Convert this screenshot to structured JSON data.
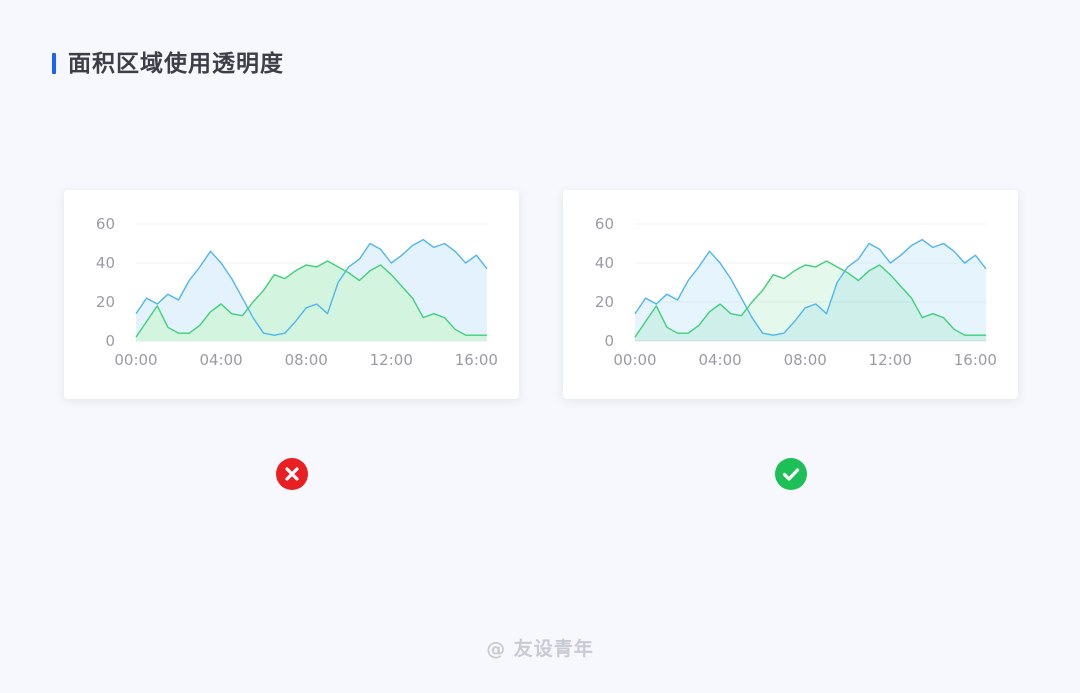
{
  "heading": {
    "title": "面积区域使用透明度"
  },
  "chart_data": [
    {
      "type": "area",
      "variant": "opaque-fill",
      "x": [
        "00:00",
        "00:30",
        "01:00",
        "01:30",
        "02:00",
        "02:30",
        "03:00",
        "03:30",
        "04:00",
        "04:30",
        "05:00",
        "05:30",
        "06:00",
        "06:30",
        "07:00",
        "07:30",
        "08:00",
        "08:30",
        "09:00",
        "09:30",
        "10:00",
        "10:30",
        "11:00",
        "11:30",
        "12:00",
        "12:30",
        "13:00",
        "13:30",
        "14:00",
        "14:30",
        "15:00",
        "15:30",
        "16:00",
        "16:30"
      ],
      "x_ticks": [
        "00:00",
        "04:00",
        "08:00",
        "12:00",
        "16:00"
      ],
      "y_ticks": [
        "0",
        "20",
        "40",
        "60"
      ],
      "ylim": [
        0,
        60
      ],
      "grid": true,
      "series": [
        {
          "color": "#4fb6ee",
          "fill": "#e3f2fc",
          "values": [
            14,
            22,
            19,
            24,
            21,
            31,
            38,
            46,
            40,
            32,
            22,
            12,
            4,
            3,
            4,
            10,
            17,
            19,
            14,
            30,
            38,
            42,
            50,
            47,
            40,
            44,
            49,
            52,
            48,
            50,
            46,
            40,
            44,
            37
          ]
        },
        {
          "color": "#3fd07a",
          "fill": "#d3f5e0",
          "values": [
            2,
            10,
            18,
            7,
            4,
            4,
            8,
            15,
            19,
            14,
            13,
            20,
            26,
            34,
            32,
            36,
            39,
            38,
            41,
            38,
            35,
            31,
            36,
            39,
            34,
            28,
            22,
            12,
            14,
            12,
            6,
            3,
            3,
            3
          ]
        }
      ]
    },
    {
      "type": "area",
      "variant": "transparent-fill",
      "x": [
        "00:00",
        "00:30",
        "01:00",
        "01:30",
        "02:00",
        "02:30",
        "03:00",
        "03:30",
        "04:00",
        "04:30",
        "05:00",
        "05:30",
        "06:00",
        "06:30",
        "07:00",
        "07:30",
        "08:00",
        "08:30",
        "09:00",
        "09:30",
        "10:00",
        "10:30",
        "11:00",
        "11:30",
        "12:00",
        "12:30",
        "13:00",
        "13:30",
        "14:00",
        "14:30",
        "15:00",
        "15:30",
        "16:00",
        "16:30"
      ],
      "x_ticks": [
        "00:00",
        "04:00",
        "08:00",
        "12:00",
        "16:00"
      ],
      "y_ticks": [
        "0",
        "20",
        "40",
        "60"
      ],
      "ylim": [
        0,
        60
      ],
      "grid": true,
      "series": [
        {
          "color": "#4fb6ee",
          "fill": "rgba(79,182,238,0.14)",
          "values": [
            14,
            22,
            19,
            24,
            21,
            31,
            38,
            46,
            40,
            32,
            22,
            12,
            4,
            3,
            4,
            10,
            17,
            19,
            14,
            30,
            38,
            42,
            50,
            47,
            40,
            44,
            49,
            52,
            48,
            50,
            46,
            40,
            44,
            37
          ]
        },
        {
          "color": "#3fd07a",
          "fill": "rgba(63,208,122,0.14)",
          "values": [
            2,
            10,
            18,
            7,
            4,
            4,
            8,
            15,
            19,
            14,
            13,
            20,
            26,
            34,
            32,
            36,
            39,
            38,
            41,
            38,
            35,
            31,
            36,
            39,
            34,
            28,
            22,
            12,
            14,
            12,
            6,
            3,
            3,
            3
          ]
        }
      ]
    }
  ],
  "verdicts": [
    {
      "icon": "cross-icon",
      "meaning": "wrong",
      "color": "#ea1f24"
    },
    {
      "icon": "check-icon",
      "meaning": "correct",
      "color": "#1dbf57"
    }
  ],
  "watermark": {
    "text": "@ 友设青年"
  }
}
